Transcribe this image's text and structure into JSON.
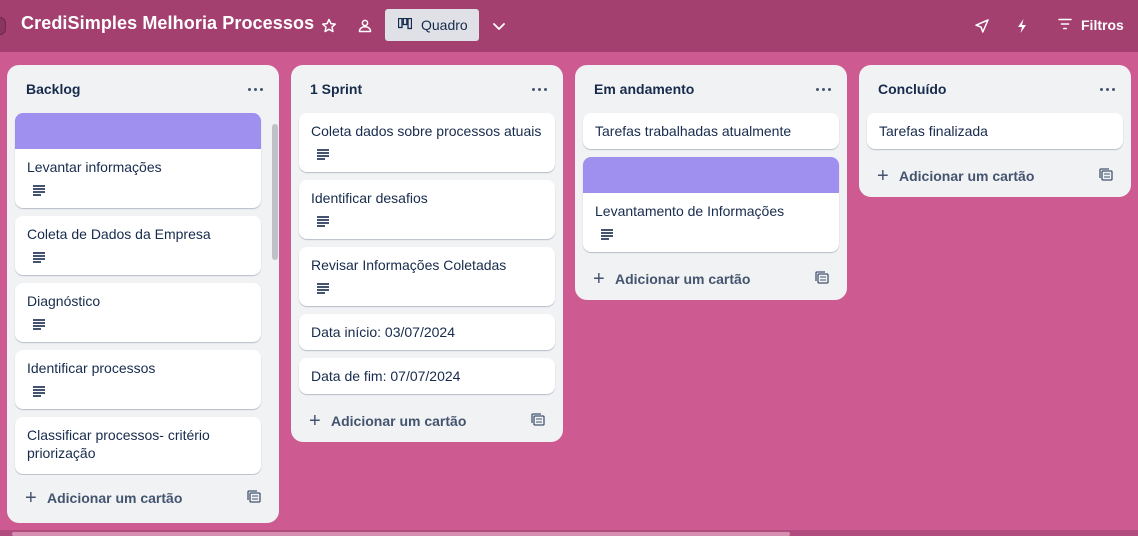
{
  "board": {
    "title": "CrediSimples Melhoria Processos",
    "view_label": "Quadro",
    "filters_label": "Filtros"
  },
  "colors": {
    "background": "#cd5a91",
    "header": "#a3406f",
    "card_cover": "#9f8fef"
  },
  "icons": {
    "star": "star-icon",
    "workspace": "people-icon",
    "view": "board-icon",
    "chevron": "chevron-down-icon",
    "power_ups": "rocket-icon",
    "automation": "lightning-icon",
    "filter": "filter-icon"
  },
  "add_card_label": "Adicionar um cartão",
  "lists": [
    {
      "title": "Backlog",
      "cards": [
        {
          "text": "Levantar informações",
          "cover": true,
          "desc": true
        },
        {
          "text": "Coleta de Dados da Empresa",
          "cover": false,
          "desc": true
        },
        {
          "text": "Diagnóstico",
          "cover": false,
          "desc": true
        },
        {
          "text": "Identificar processos",
          "cover": false,
          "desc": true
        },
        {
          "text": "Classificar processos- critério priorização",
          "cover": false,
          "desc": false
        }
      ]
    },
    {
      "title": "1 Sprint",
      "cards": [
        {
          "text": "Coleta dados sobre processos atuais",
          "cover": false,
          "desc": true
        },
        {
          "text": "Identificar desafios",
          "cover": false,
          "desc": true
        },
        {
          "text": "Revisar Informações Coletadas",
          "cover": false,
          "desc": true
        },
        {
          "text": "Data início: 03/07/2024",
          "cover": false,
          "desc": false
        },
        {
          "text": "Data de fim: 07/07/2024",
          "cover": false,
          "desc": false
        }
      ]
    },
    {
      "title": "Em andamento",
      "cards": [
        {
          "text": "Tarefas trabalhadas atualmente",
          "cover": false,
          "desc": false
        },
        {
          "text": "Levantamento de Informações",
          "cover": true,
          "desc": true
        }
      ]
    },
    {
      "title": "Concluído",
      "cards": [
        {
          "text": "Tarefas finalizada",
          "cover": false,
          "desc": false
        }
      ]
    }
  ]
}
